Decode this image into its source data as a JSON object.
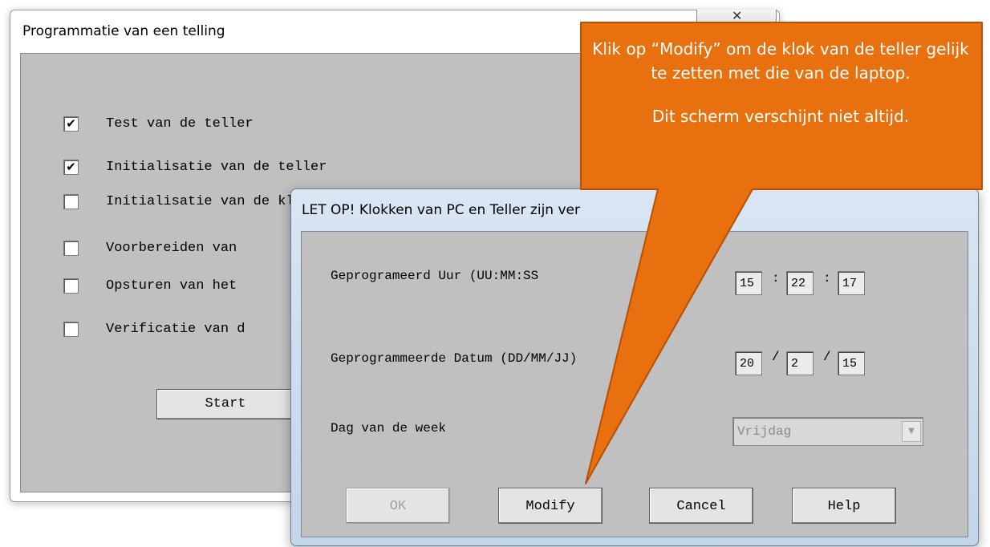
{
  "back_window": {
    "title": "Programmatie van een telling",
    "close_glyph": "✕",
    "options": [
      {
        "label": "Test van de teller",
        "checked": true
      },
      {
        "label": "Initialisatie van de teller",
        "checked": true
      },
      {
        "label": "Initialisatie van de klok",
        "checked": false
      },
      {
        "label": "Voorbereiden van",
        "checked": false
      },
      {
        "label": "Opsturen van het",
        "checked": false
      },
      {
        "label": "Verificatie van d",
        "checked": false
      }
    ],
    "start_label": "Start"
  },
  "front_window": {
    "title": "LET OP! Klokken van PC en Teller zijn ver",
    "hour_label": "Geprogrameerd Uur (UU:MM:SS",
    "hour_values": [
      "15",
      "22",
      "17"
    ],
    "hour_sep": ":",
    "date_label": "Geprogrammeerde Datum  (DD/MM/JJ)",
    "date_values": [
      "20",
      "2",
      "15"
    ],
    "date_sep": "/",
    "weekday_label": "Dag van de week",
    "weekday_value": "Vrijdag",
    "buttons": {
      "ok": "OK",
      "modify": "Modify",
      "cancel": "Cancel",
      "help": "Help"
    }
  },
  "callout": {
    "line1": "Klik op “Modify” om de klok van de teller gelijk te zetten met die van de laptop.",
    "line2": "Dit scherm verschijnt niet altijd.",
    "fill_color": "#e8700e",
    "border_color": "#b94f06"
  }
}
